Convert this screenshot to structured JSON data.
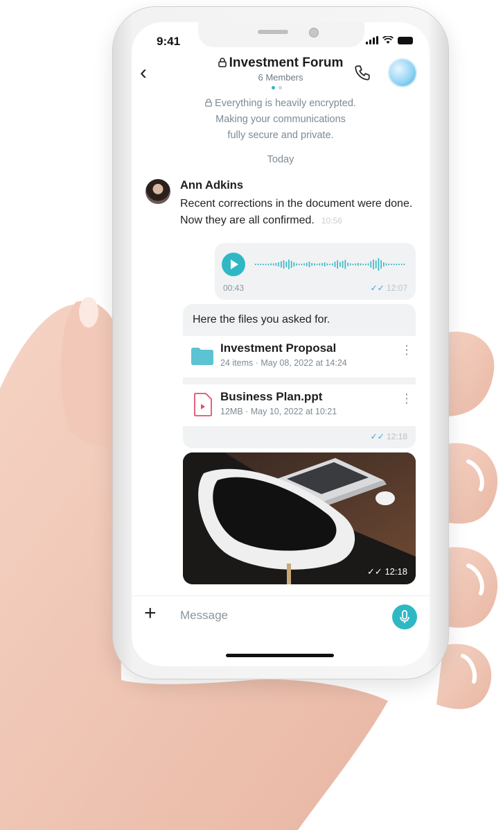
{
  "status": {
    "time": "9:41"
  },
  "header": {
    "title": "Investment Forum",
    "members": "6 Members"
  },
  "encryption": {
    "line1": "Everything is heavily encrypted.",
    "line2": "Making your communications",
    "line3": "fully secure and private."
  },
  "date_separator": "Today",
  "messages": {
    "ann": {
      "name": "Ann Adkins",
      "text": "Recent corrections in the document were done. Now they are all confirmed.",
      "time": "10:56"
    },
    "voice": {
      "duration": "00:43",
      "time": "12:07"
    },
    "files": {
      "text": "Here the files you asked for.",
      "time": "12:18",
      "items": [
        {
          "name": "Investment Proposal",
          "meta": "24 items · May 08, 2022 at 14:24",
          "icon": "folder-icon"
        },
        {
          "name": "Business Plan.ppt",
          "meta": "12MB · May 10, 2022 at 10:21",
          "icon": "document-icon"
        }
      ]
    },
    "photo": {
      "time": "12:18"
    }
  },
  "composer": {
    "placeholder": "Message"
  },
  "colors": {
    "accent": "#2fb8c4",
    "tick": "#3aa7d5",
    "bubble": "#f0f2f4"
  }
}
